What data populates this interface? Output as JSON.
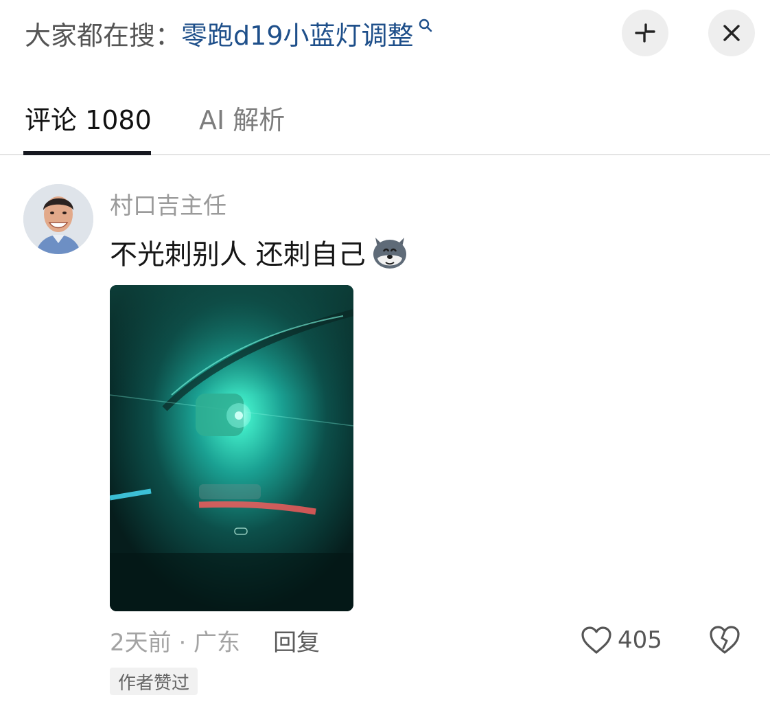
{
  "search": {
    "prefix": "大家都在搜：",
    "query": "零跑d19小蓝灯调整",
    "icon": "search-icon"
  },
  "header_buttons": {
    "collapse_icon": "collapse-icon",
    "close_icon": "close-icon"
  },
  "tabs": [
    {
      "label": "评论 1080",
      "active": true
    },
    {
      "label": "AI 解析",
      "active": false
    }
  ],
  "comment": {
    "username": "村口吉主任",
    "text": "不光刺别人 还刺自己",
    "emoji": "husky-emoji",
    "time_location": "2天前 · 广东",
    "reply_label": "回复",
    "like_count": "405",
    "author_badge": "作者赞过"
  },
  "colors": {
    "accent_link": "#1e4f8a",
    "tab_underline": "#16181f",
    "muted_text": "#9a9a9a"
  }
}
